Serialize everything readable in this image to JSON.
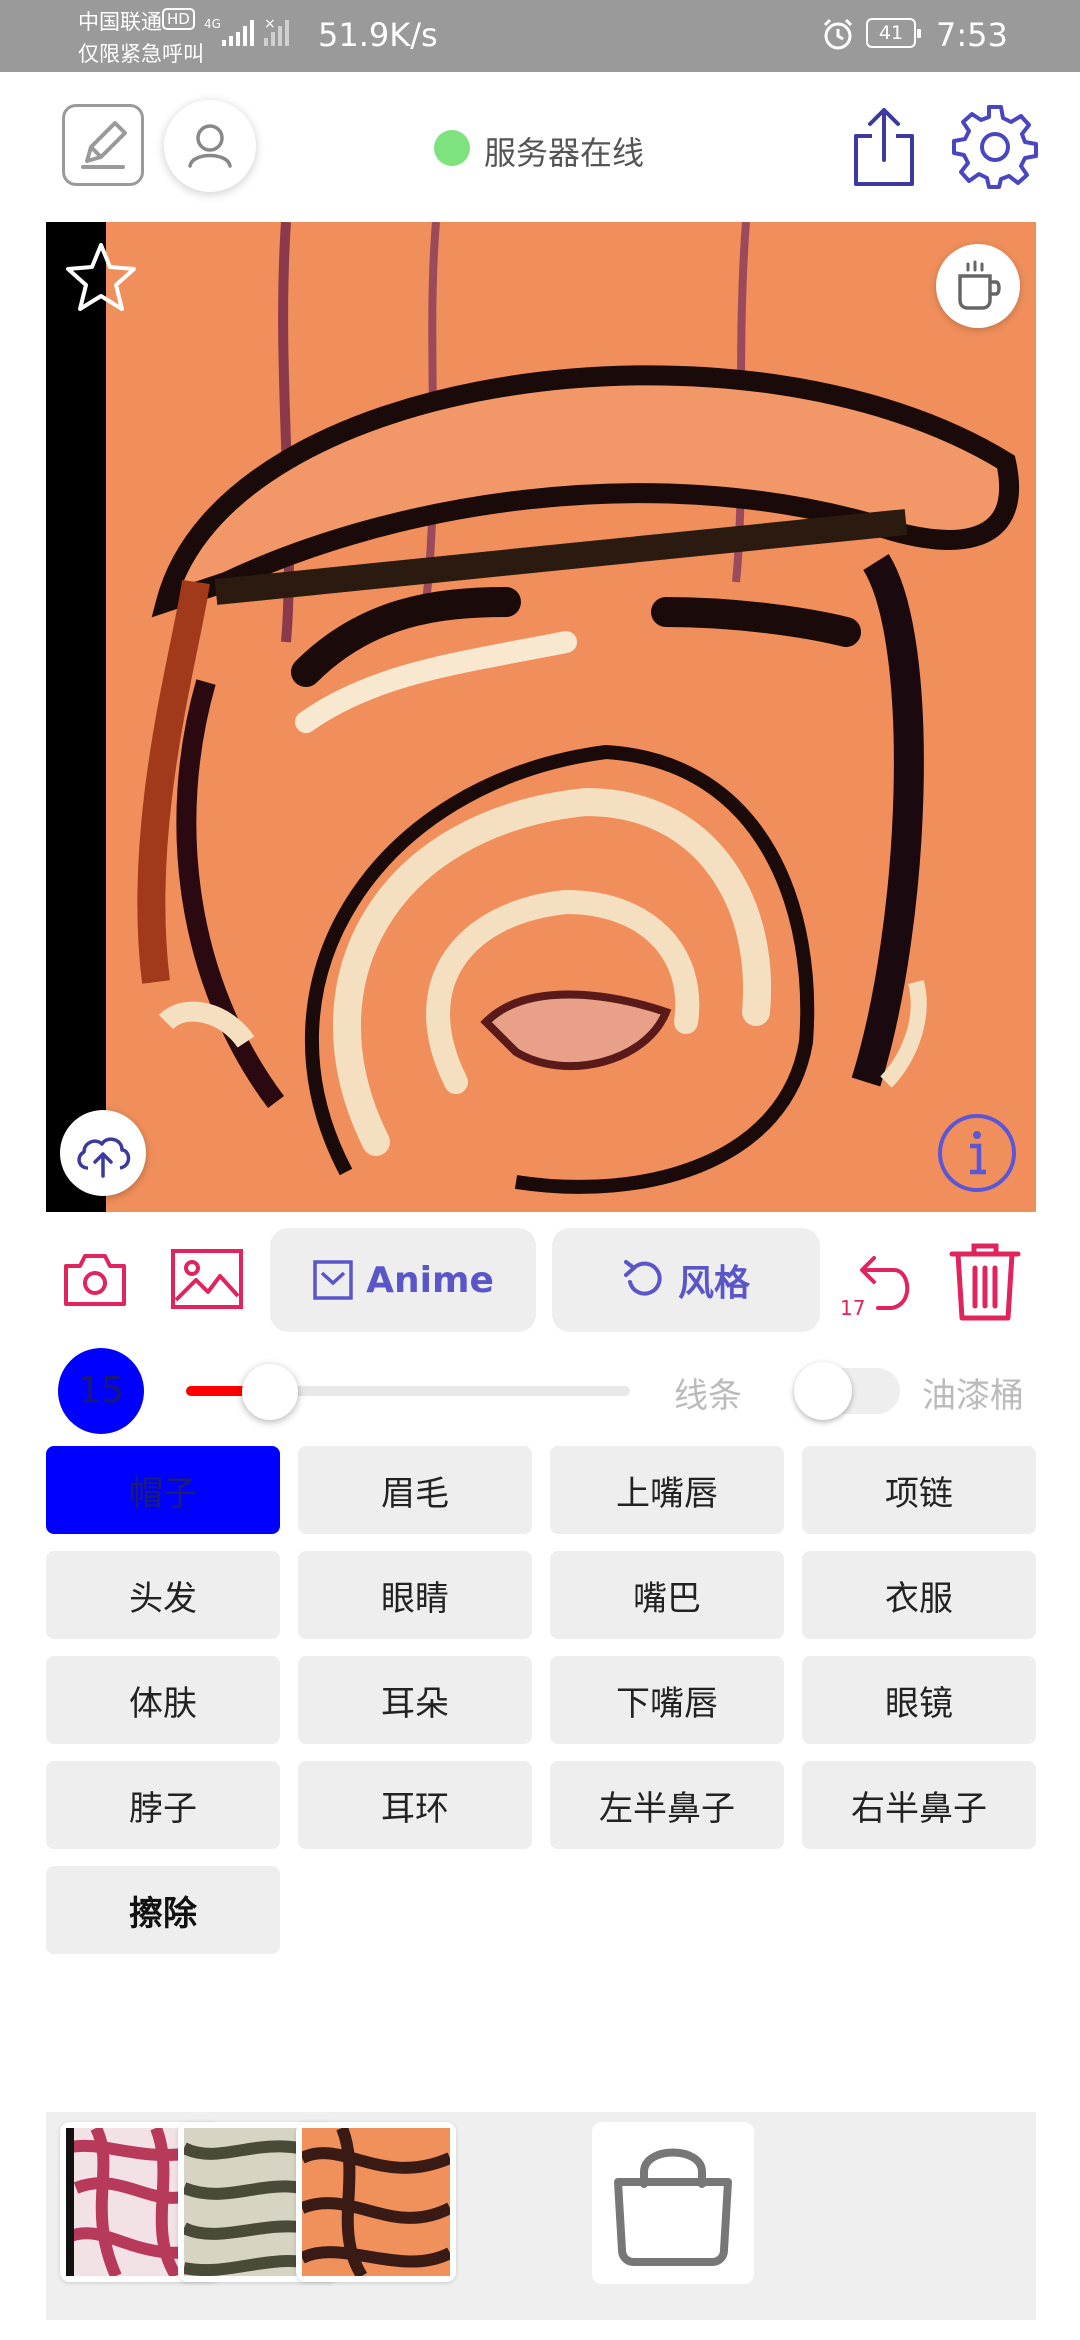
{
  "status_bar": {
    "carrier_line1": "中国联通",
    "hd_badge": "HD",
    "carrier_line2": "仅限紧急呼叫",
    "network_speed": "51.9K/s",
    "battery": "41",
    "time": "7:53"
  },
  "header": {
    "server_status": "服务器在线",
    "server_status_color": "#7ee37e"
  },
  "toolbar": {
    "anime_label": "Anime",
    "style_label": "风格",
    "undo_count": "17",
    "accent_color": "#e0245e",
    "pill_text_color": "#5a56c8"
  },
  "brush": {
    "size": "15",
    "size_fraction": 0.19,
    "mode_line_label": "线条",
    "mode_bucket_label": "油漆桶",
    "bucket_enabled": false
  },
  "parts": [
    {
      "label": "帽子",
      "selected": true
    },
    {
      "label": "眉毛",
      "selected": false
    },
    {
      "label": "上嘴唇",
      "selected": false
    },
    {
      "label": "项链",
      "selected": false
    },
    {
      "label": "头发",
      "selected": false
    },
    {
      "label": "眼睛",
      "selected": false
    },
    {
      "label": "嘴巴",
      "selected": false
    },
    {
      "label": "衣服",
      "selected": false
    },
    {
      "label": "体肤",
      "selected": false
    },
    {
      "label": "耳朵",
      "selected": false
    },
    {
      "label": "下嘴唇",
      "selected": false
    },
    {
      "label": "眼镜",
      "selected": false
    },
    {
      "label": "脖子",
      "selected": false
    },
    {
      "label": "耳环",
      "selected": false
    },
    {
      "label": "左半鼻子",
      "selected": false
    },
    {
      "label": "右半鼻子",
      "selected": false
    },
    {
      "label": "擦除",
      "selected": false
    }
  ],
  "icons": {
    "edit": "edit-icon",
    "user": "user-icon",
    "share": "share-icon",
    "settings": "gear-icon",
    "star": "star-icon",
    "cup": "coffee-cup-icon",
    "upload": "cloud-upload-icon",
    "info": "info-icon",
    "camera": "camera-icon",
    "image": "image-icon",
    "undo": "undo-icon",
    "trash": "trash-icon",
    "shop": "shopping-bag-icon"
  }
}
